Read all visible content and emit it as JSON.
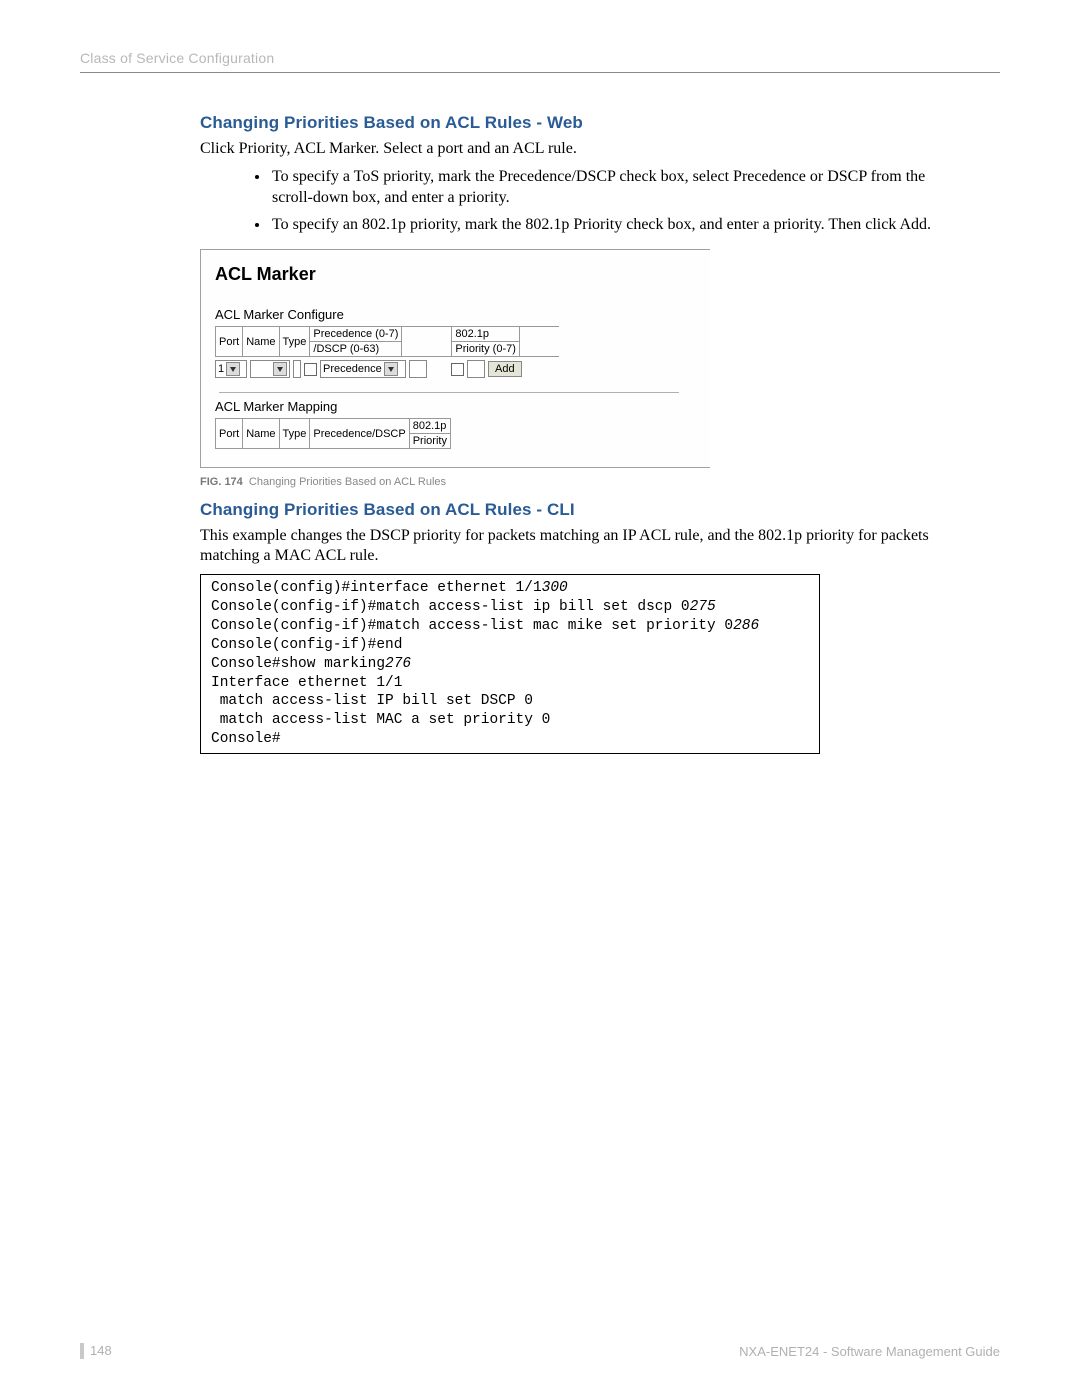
{
  "header": "Class of Service Configuration",
  "section_web": {
    "title": "Changing Priorities Based on ACL Rules - Web",
    "intro": "Click Priority, ACL Marker. Select a port and an ACL rule.",
    "bullets": [
      "To specify a ToS priority, mark the Precedence/DSCP check box, select Precedence or DSCP from the scroll-down box, and enter a priority.",
      "To specify an 802.1p priority, mark the 802.1p Priority check box, and enter a priority. Then click Add."
    ]
  },
  "figure": {
    "title": "ACL Marker",
    "configure_label": "ACL Marker Configure",
    "headers": {
      "port": "Port",
      "name": "Name",
      "type": "Type",
      "pd1": "Precedence (0-7)",
      "pd2": "/DSCP (0-63)",
      "p1": "802.1p",
      "p2": "Priority (0-7)"
    },
    "row": {
      "port_value": "1",
      "select_label": "Precedence",
      "add_btn": "Add"
    },
    "mapping_label": "ACL Marker Mapping",
    "map_headers": {
      "port": "Port",
      "name": "Name",
      "type": "Type",
      "pd": "Precedence/DSCP",
      "p1": "802.1p",
      "p2": "Priority"
    },
    "caption_prefix": "FIG. 174",
    "caption_text": "Changing Priorities Based on ACL Rules"
  },
  "section_cli": {
    "title": "Changing Priorities Based on ACL Rules - CLI",
    "intro": "This example changes the DSCP priority for packets matching an IP ACL rule, and the 802.1p priority for packets matching a MAC ACL rule.",
    "lines": [
      {
        "pre": "Console(config)#interface ethernet 1/1",
        "em": "300"
      },
      {
        "pre": "Console(config-if)#match access-list ip bill set dscp 0",
        "em": "275"
      },
      {
        "pre": "Console(config-if)#match access-list mac mike set priority 0",
        "em": "286"
      },
      {
        "pre": "Console(config-if)#end",
        "em": ""
      },
      {
        "pre": "Console#show marking",
        "em": "276"
      },
      {
        "pre": "Interface ethernet 1/1",
        "em": ""
      },
      {
        "pre": " match access-list IP bill set DSCP 0",
        "em": ""
      },
      {
        "pre": " match access-list MAC a set priority 0",
        "em": ""
      },
      {
        "pre": "Console#",
        "em": ""
      }
    ]
  },
  "footer": {
    "page": "148",
    "right": "NXA-ENET24 - Software Management Guide"
  }
}
